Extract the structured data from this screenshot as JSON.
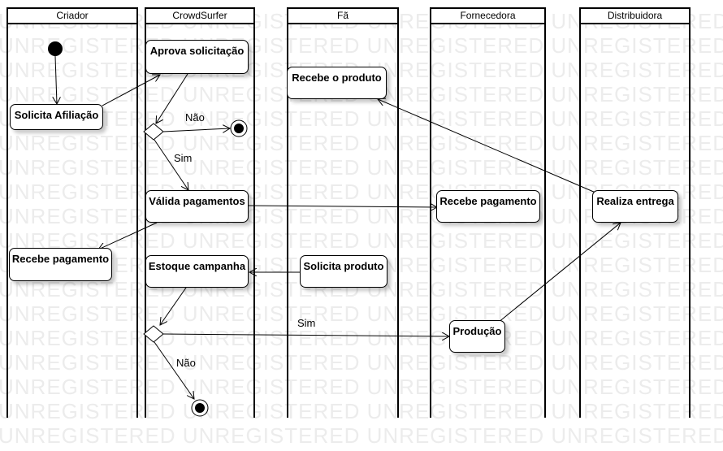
{
  "watermark": "UNREGISTERED",
  "lanes": {
    "criador": "Criador",
    "crowdsurfer": "CrowdSurfer",
    "fa": "Fã",
    "fornecedora": "Fornecedora",
    "distribuidora": "Distribuidora"
  },
  "actions": {
    "aprova_solicitacao": "Aprova solicitação",
    "solicita_afiliacao": "Solicita Afiliação",
    "recebe_produto": "Recebe o produto",
    "valida_pagamentos": "Válida pagamentos",
    "recebe_pagamento_fornecedora": "Recebe pagamento",
    "realiza_entrega": "Realiza entrega",
    "recebe_pagamento_criador": "Recebe pagamento",
    "estoque_campanha": "Estoque campanha",
    "solicita_produto": "Solicita produto",
    "producao": "Produção"
  },
  "guards": {
    "nao_1": "Não",
    "sim_1": "Sim",
    "sim_2": "Sim",
    "nao_2": "Não"
  },
  "colors": {
    "line": "#000000",
    "watermark": "#ececec",
    "node_fill": "#ffffff"
  }
}
